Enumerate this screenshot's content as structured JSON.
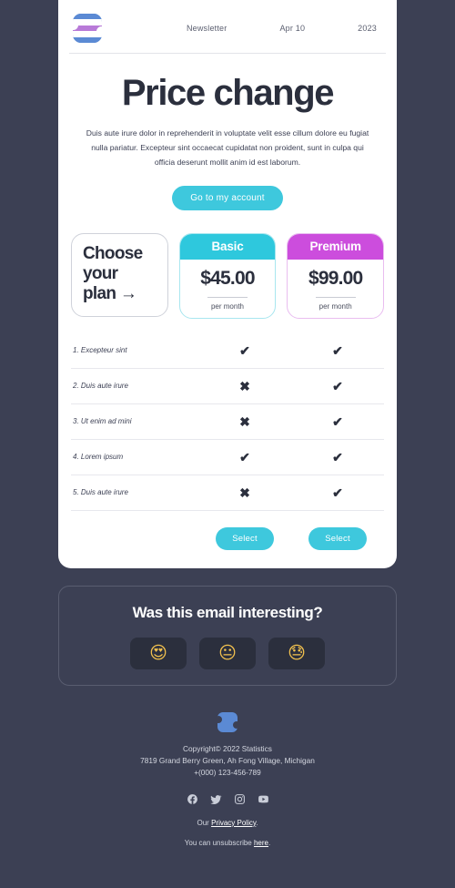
{
  "theme": {
    "page_bg": "#3c4054",
    "card_bg": "#ffffff",
    "accent_cyan": "#3ec8dd",
    "accent_basic": "#2ec8dd",
    "accent_premium": "#cc4ddd",
    "text_dark": "#2b2f3d"
  },
  "header": {
    "logo_icon": "brand-s-logo-icon",
    "label": "Newsletter",
    "date": "Apr 10",
    "year": "2023"
  },
  "hero": {
    "title": "Price change",
    "body": "Duis aute irure dolor in reprehenderit in voluptate velit esse cillum dolore eu fugiat nulla pariatur. Excepteur sint occaecat cupidatat non proident, sunt in culpa qui officia deserunt mollit anim id est laborum.",
    "cta_label": "Go to my account"
  },
  "plans": {
    "choose_line1": "Choose",
    "choose_line2": "your",
    "choose_line3": "plan",
    "choose_arrow": "→",
    "basic": {
      "name": "Basic",
      "price": "$45.00",
      "period": "per month",
      "select_label": "Select"
    },
    "premium": {
      "name": "Premium",
      "price": "$99.00",
      "period": "per month",
      "select_label": "Select"
    }
  },
  "features": [
    {
      "name": "1. Excepteur sint",
      "basic": "yes",
      "premium": "yes"
    },
    {
      "name": "2. Duis aute irure",
      "basic": "no",
      "premium": "yes"
    },
    {
      "name": "3. Ut enim ad mini",
      "basic": "no",
      "premium": "yes"
    },
    {
      "name": "4. Lorem ipsum",
      "basic": "yes",
      "premium": "yes"
    },
    {
      "name": "5. Duis aute irure",
      "basic": "no",
      "premium": "yes"
    }
  ],
  "feedback": {
    "title": "Was this email interesting?",
    "options": [
      {
        "icon": "heart-eyes-emoji",
        "glyph": "😍"
      },
      {
        "icon": "neutral-face-emoji",
        "glyph": "😐"
      },
      {
        "icon": "sad-sweat-face-emoji",
        "glyph": "😓"
      }
    ]
  },
  "footer": {
    "logo_icon": "brand-s-logo-icon",
    "copyright": "Copyright© 2022 Statistics",
    "address": "7819 Grand Berry Green, Ah Fong Village, Michigan",
    "phone": "+(000) 123-456-789",
    "social": [
      {
        "icon": "facebook-icon"
      },
      {
        "icon": "twitter-icon"
      },
      {
        "icon": "instagram-icon"
      },
      {
        "icon": "youtube-icon"
      }
    ],
    "privacy_prefix": "Our ",
    "privacy_link": "Privacy Policy",
    "privacy_suffix": ".",
    "unsub_prefix": "You can unsubscribe ",
    "unsub_link": "here",
    "unsub_suffix": "."
  }
}
